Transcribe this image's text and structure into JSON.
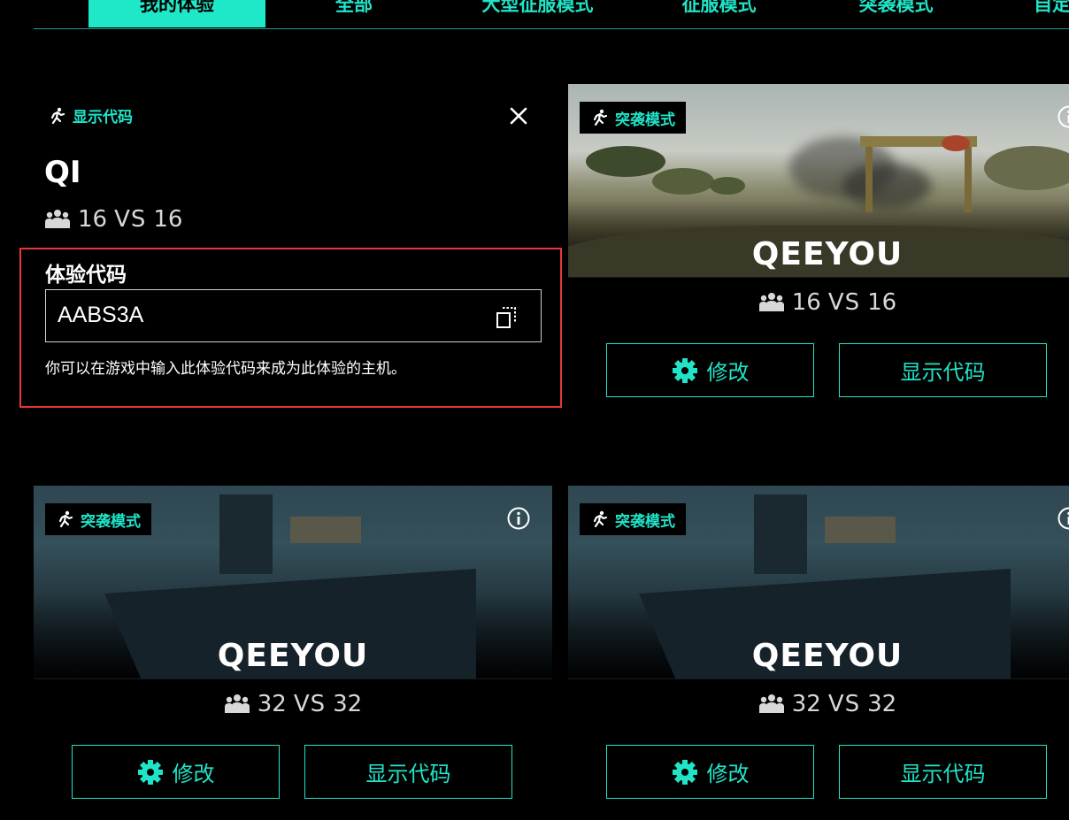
{
  "tabs": [
    {
      "label": "我的体验",
      "active": true
    },
    {
      "label": "全部",
      "active": false
    },
    {
      "label": "大型征服模式",
      "active": false
    },
    {
      "label": "征服模式",
      "active": false
    },
    {
      "label": "突袭模式",
      "active": false
    },
    {
      "label": "自定",
      "active": false
    }
  ],
  "panel": {
    "mode_label": "显示代码",
    "title": "QI",
    "team_a": "16",
    "vs": "VS",
    "team_b": "16",
    "code_label": "体验代码",
    "code_value": "AABS3A",
    "code_hint": "你可以在游戏中输入此体验代码来成为此体验的主机。"
  },
  "cards": [
    {
      "badge": "突袭模式",
      "name": "QEEYOU",
      "team_a": "16",
      "vs": "VS",
      "team_b": "16",
      "edit_label": "修改",
      "show_code_label": "显示代码",
      "image": "desert-outpost"
    },
    {
      "badge": "突袭模式",
      "name": "QEEYOU",
      "team_a": "32",
      "vs": "VS",
      "team_b": "32",
      "edit_label": "修改",
      "show_code_label": "显示代码",
      "image": "aircraft-carrier"
    },
    {
      "badge": "突袭模式",
      "name": "QEEYOU",
      "team_a": "32",
      "vs": "VS",
      "team_b": "32",
      "edit_label": "修改",
      "show_code_label": "显示代码",
      "image": "aircraft-carrier"
    }
  ],
  "icons": {
    "mode": "running-person-icon",
    "close": "close-icon",
    "copy": "copy-icon",
    "players": "players-icon",
    "gear": "gear-icon",
    "info": "info-icon"
  },
  "colors": {
    "accent": "#20e4c8",
    "highlight_border": "#e53935",
    "background": "#000000"
  }
}
